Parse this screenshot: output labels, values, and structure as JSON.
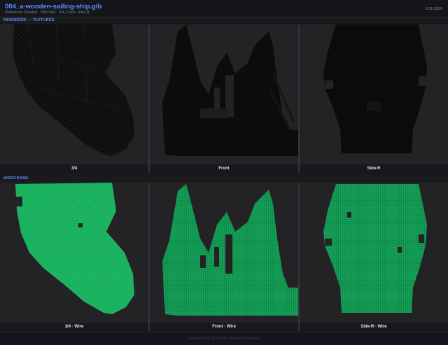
{
  "header": {
    "title": "004_a-wooden-sailing-ship.glb",
    "meta": "Reference Shaded · 384×384 · 3/4, Front, Side-R",
    "date": "6/11/2026"
  },
  "sections": {
    "rendered_label": "RENDERED — TEXTURED",
    "wireframe_label": "WIREFRAME"
  },
  "views": {
    "three_quarter": "3/4",
    "front": "Front",
    "side_r": "Side-R",
    "three_quarter_wire": "3/4 · Wire",
    "front_wire": "Front · Wire",
    "side_r_wire": "Side-R · Wire"
  },
  "colors": {
    "background": "#232326",
    "textured_mesh": "#0a0a0a",
    "wire_mesh": "#1fbf6a",
    "accent": "#5b8cff"
  },
  "footer": {
    "text": "Generated by 3D Viewer · Reference Shaded"
  }
}
